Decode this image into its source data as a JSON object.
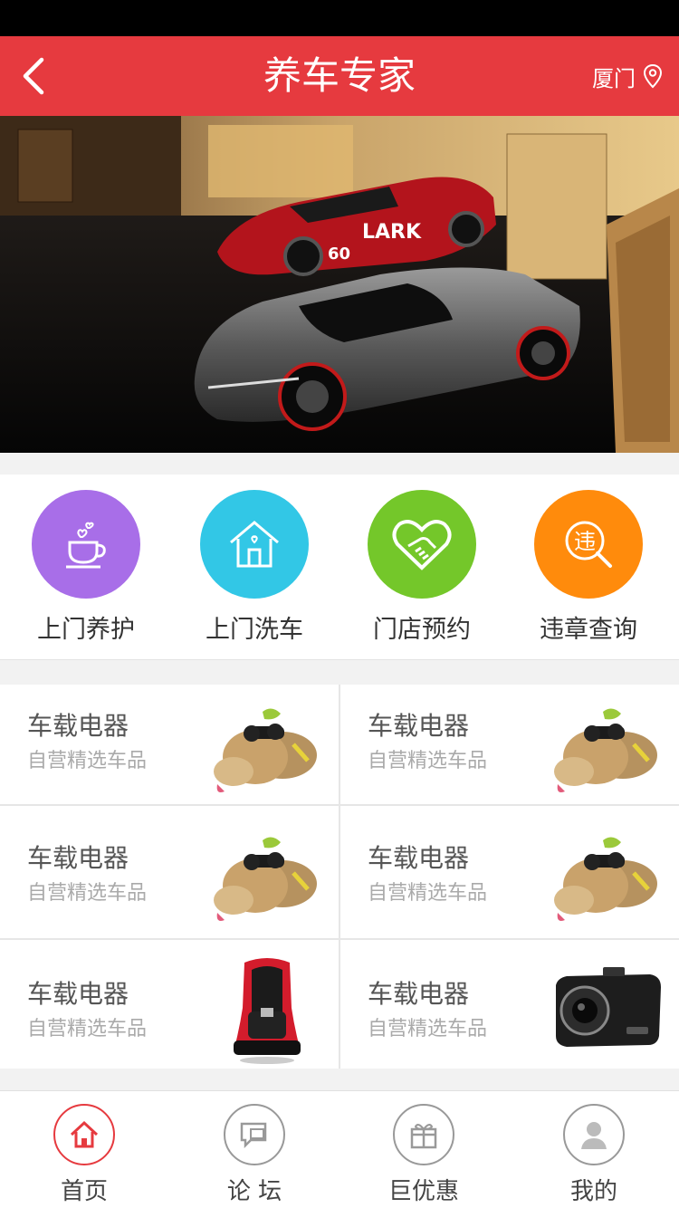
{
  "header": {
    "title": "养车专家",
    "city": "厦门"
  },
  "services": [
    {
      "label": "上门养护",
      "icon": "coffee-cup-icon",
      "color": "#a86ee8"
    },
    {
      "label": "上门洗车",
      "icon": "house-icon",
      "color": "#32c7e6"
    },
    {
      "label": "门店预约",
      "icon": "handshake-heart-icon",
      "color": "#74c72a"
    },
    {
      "label": "违章查询",
      "icon": "search-violation-icon",
      "color": "#ff8b0c",
      "glyph": "违"
    }
  ],
  "products": [
    {
      "title": "车载电器",
      "subtitle": "自营精选车品",
      "image": "plush-dog-toy"
    },
    {
      "title": "车载电器",
      "subtitle": "自营精选车品",
      "image": "plush-dog-toy"
    },
    {
      "title": "车载电器",
      "subtitle": "自营精选车品",
      "image": "plush-dog-toy"
    },
    {
      "title": "车载电器",
      "subtitle": "自营精选车品",
      "image": "plush-dog-toy"
    },
    {
      "title": "车载电器",
      "subtitle": "自营精选车品",
      "image": "child-car-seat"
    },
    {
      "title": "车载电器",
      "subtitle": "自营精选车品",
      "image": "dash-camera"
    }
  ],
  "tabbar": [
    {
      "label": "首页",
      "icon": "home-icon",
      "active": true
    },
    {
      "label": "论 坛",
      "icon": "forum-icon",
      "active": false
    },
    {
      "label": "巨优惠",
      "icon": "gift-icon",
      "active": false
    },
    {
      "label": "我的",
      "icon": "user-icon",
      "active": false
    }
  ],
  "colors": {
    "accent": "#e63a3f",
    "status_bar": "#000000"
  },
  "banner": {
    "image": "two sports cars in garage",
    "car_text": "LARK",
    "race_number": "60"
  }
}
